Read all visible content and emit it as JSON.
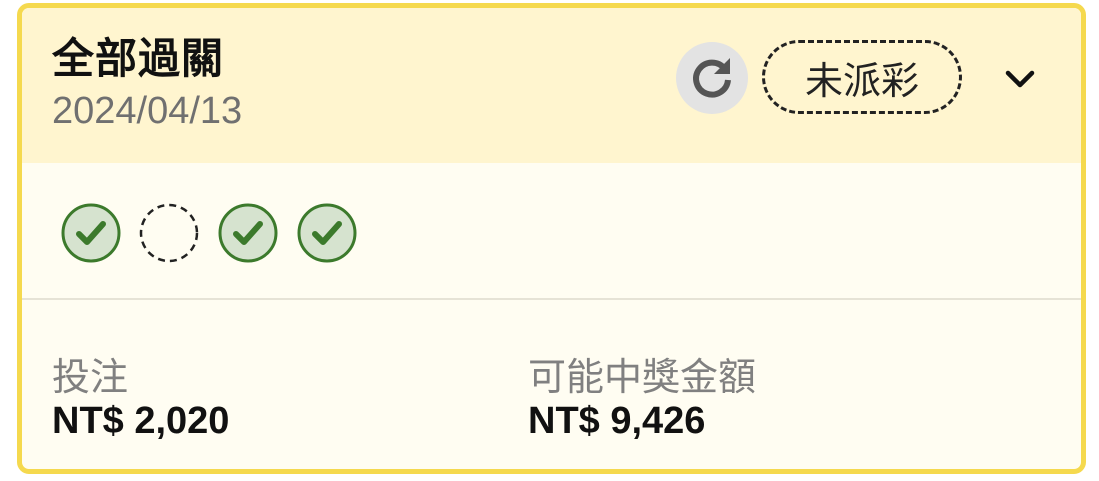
{
  "bet": {
    "title": "全部過關",
    "date": "2024/04/13",
    "status_label": "未派彩"
  },
  "legs": [
    {
      "state": "won"
    },
    {
      "state": "pending"
    },
    {
      "state": "won"
    },
    {
      "state": "won"
    }
  ],
  "stats": {
    "stake_label": "投注",
    "stake_value": "NT$ 2,020",
    "payout_label": "可能中獎金額",
    "payout_value": "NT$ 9,426"
  },
  "icons": {
    "refresh": "refresh-icon",
    "expand": "chevron-down-icon",
    "won": "check-circle-icon",
    "pending": "pending-circle-icon"
  },
  "colors": {
    "accent_border": "#f5d94e",
    "header_bg": "#fff5cf",
    "body_bg": "#fffdf2",
    "won_green": "#3c7a2c",
    "won_fill": "#d6e3cf"
  }
}
